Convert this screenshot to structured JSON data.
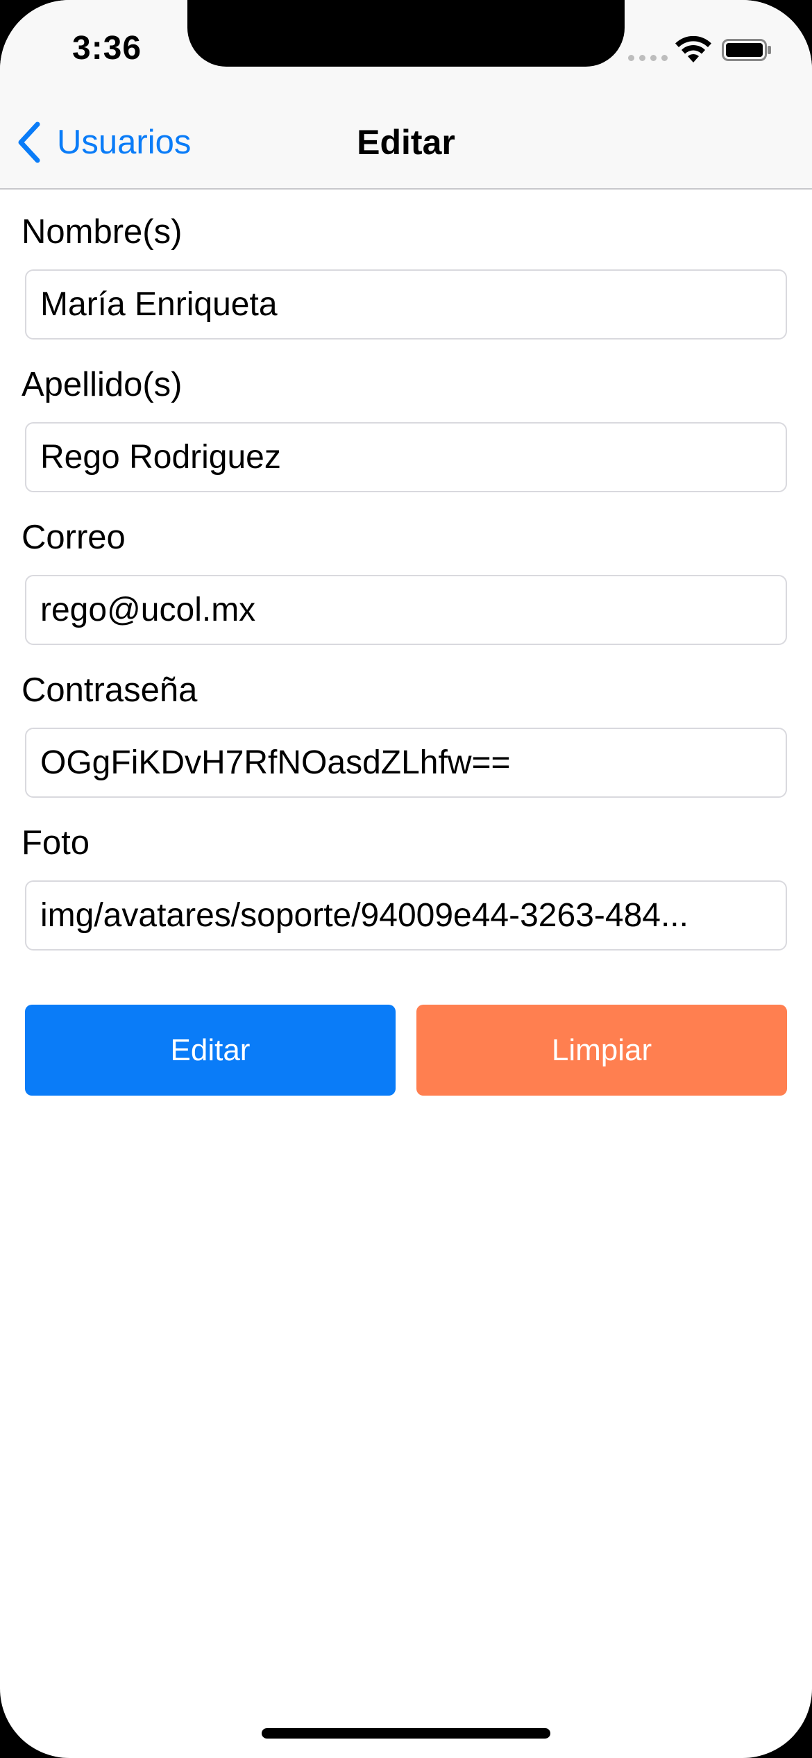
{
  "status_bar": {
    "time": "3:36",
    "icons": [
      "signal-icon",
      "wifi-icon",
      "battery-icon"
    ]
  },
  "nav": {
    "back_label": "Usuarios",
    "back_icon": "chevron-left-icon",
    "title": "Editar"
  },
  "form": {
    "fields": [
      {
        "label": "Nombre(s)",
        "value": "María Enriqueta"
      },
      {
        "label": "Apellido(s)",
        "value": "Rego Rodriguez"
      },
      {
        "label": "Correo",
        "value": "rego@ucol.mx"
      },
      {
        "label": "Contraseña",
        "value": "OGgFiKDvH7RfNOasdZLhfw=="
      },
      {
        "label": "Foto",
        "value": "img/avatares/soporte/94009e44-3263-484..."
      }
    ]
  },
  "buttons": {
    "edit_label": "Editar",
    "clear_label": "Limpiar"
  },
  "colors": {
    "accent": "#0a7cf8",
    "clear_button": "#ff7f50",
    "background": "#ffffff",
    "bar_background": "#f8f8f8"
  }
}
